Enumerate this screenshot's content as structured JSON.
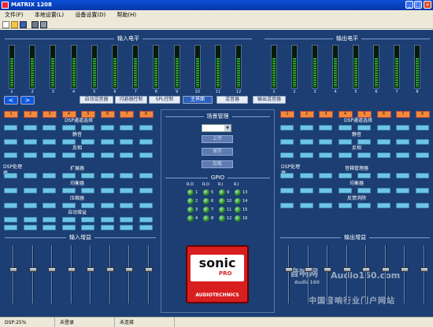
{
  "window": {
    "title": "MATRIX 1208"
  },
  "menu": {
    "items": [
      "文件(F)",
      "本地设置(L)",
      "设备设置(D)",
      "帮助(H)"
    ]
  },
  "input_level": {
    "title": "输入电平",
    "channels": [
      "1",
      "2",
      "3",
      "4",
      "5",
      "6",
      "7",
      "8",
      "9",
      "10",
      "11",
      "12"
    ]
  },
  "output_level": {
    "title": "输出电平",
    "channels": [
      "1",
      "2",
      "3",
      "4",
      "5",
      "6",
      "7",
      "8"
    ]
  },
  "nav": {
    "prev": "<",
    "next": ">"
  },
  "tabs": [
    "自动混音器",
    "闪避器控制",
    "SPL控制",
    "主界面",
    "混音器",
    "输出混音器"
  ],
  "left_panel": {
    "channels": [
      "1",
      "2",
      "3",
      "4",
      "5",
      "6",
      "7",
      "8"
    ],
    "labels": {
      "dsp_select": "DSP通道选择",
      "mute": "静音",
      "invert": "反相",
      "dsp_processor": "DSP处理器",
      "expander": "扩展器",
      "eq": "均衡器",
      "compressor": "压缩器",
      "auto_gain": "自动增益"
    }
  },
  "right_panel": {
    "channels": [
      "1",
      "2",
      "3",
      "4",
      "5",
      "6",
      "7",
      "8"
    ],
    "labels": {
      "dsp_select": "DSP通道选择",
      "mute": "静音",
      "invert": "反相",
      "dsp_processor": "DSP处理器",
      "speaker_mgr": "音箱管理器",
      "eq": "均衡器",
      "feedback": "反馈消除"
    }
  },
  "scene": {
    "title": "场景管理",
    "upload": "上传",
    "save": "保存",
    "load": "加载"
  },
  "gpio": {
    "title": "GPIO",
    "cols": [
      "R.O",
      "R.O",
      "R.I",
      "R.I"
    ],
    "numbers": [
      [
        "1",
        "5",
        "9",
        "13"
      ],
      [
        "2",
        "6",
        "10",
        "14"
      ],
      [
        "3",
        "7",
        "11",
        "15"
      ],
      [
        "4",
        "8",
        "12",
        "16"
      ]
    ]
  },
  "input_gain": {
    "title": "输入增益",
    "scale": [
      "+12",
      "+6",
      "0",
      "-6",
      "-12",
      "-18",
      "-24",
      "-30",
      "-36",
      "-42",
      "-48",
      "-56",
      "-60"
    ]
  },
  "output_gain": {
    "title": "输出增益"
  },
  "logo": {
    "brand": "sonic",
    "sub": "PRO",
    "tagline": "AUDIOTECHNICS"
  },
  "watermark": {
    "text1": "音响网",
    "text2": "Audio160.com",
    "text3": "Audio160",
    "text4": "中国音响行业门户网站"
  },
  "status": {
    "dsp": "DSP:25%",
    "login": "未登录",
    "connect": "未连接"
  },
  "colors": {
    "panel_bg": "#1c3e73",
    "button_cyan": "#6fc4e4",
    "channel_orange": "#f08a3c",
    "meter_green": "#26a52f",
    "title_blue": "#0a4fd8"
  }
}
